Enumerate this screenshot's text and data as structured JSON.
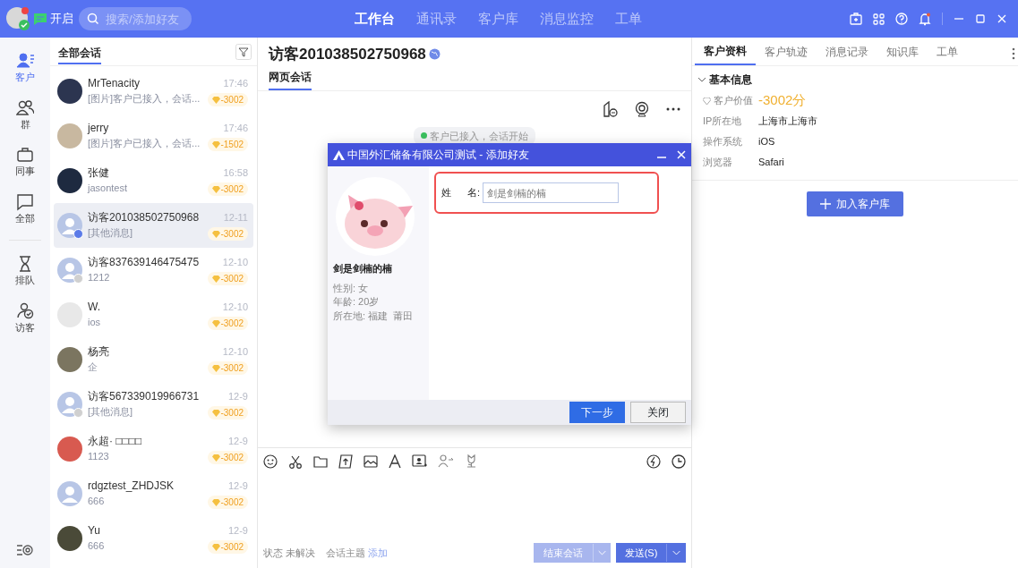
{
  "topbar": {
    "status_label": "开启",
    "search": {
      "placeholder": "搜索/添加好友"
    },
    "nav": [
      {
        "label": "工作台",
        "selected": true
      },
      {
        "label": "通讯录",
        "selected": false
      },
      {
        "label": "客户库",
        "selected": false
      },
      {
        "label": "消息监控",
        "selected": false
      },
      {
        "label": "工单",
        "selected": false
      }
    ],
    "notification_dot": true
  },
  "rail": [
    {
      "label": "客户",
      "selected": true
    },
    {
      "label": "群",
      "selected": false
    },
    {
      "label": "同事",
      "selected": false
    },
    {
      "label": "全部",
      "selected": false
    },
    {
      "label": "排队",
      "selected": false
    },
    {
      "label": "访客",
      "selected": false
    }
  ],
  "conversation_list": {
    "title": "全部会话",
    "items": [
      {
        "name": "MrTenacity",
        "time": "17:46",
        "preview": "[图片]客户已接入，会话...",
        "score": "-3002",
        "kind": "photo",
        "selected": false
      },
      {
        "name": "jerry",
        "time": "17:46",
        "preview": "[图片]客户已接入，会话...",
        "score": "-1502",
        "kind": "photo",
        "selected": false
      },
      {
        "name": "张健",
        "time": "16:58",
        "preview": "jasontest",
        "score": "-3002",
        "kind": "photo",
        "selected": false
      },
      {
        "name": "访客201038502750968",
        "time": "12-11",
        "preview": "[其他消息]",
        "score": "-3002",
        "kind": "web_visitor",
        "selected": true
      },
      {
        "name": "访客837639146475475",
        "time": "12-10",
        "preview": "1212",
        "score": "-3002",
        "kind": "offline_visitor",
        "selected": false
      },
      {
        "name": "W.",
        "time": "12-10",
        "preview": "ios",
        "score": "-3002",
        "kind": "photo",
        "selected": false
      },
      {
        "name": "杨亮",
        "time": "12-10",
        "preview": "企",
        "score": "-3002",
        "kind": "photo",
        "selected": false
      },
      {
        "name": "访客567339019966731",
        "time": "12-9",
        "preview": "[其他消息]",
        "score": "-3002",
        "kind": "offline_visitor",
        "selected": false
      },
      {
        "name": "永超· □□□□",
        "time": "12-9",
        "preview": "1123",
        "score": "-3002",
        "kind": "photo",
        "selected": false
      },
      {
        "name": "rdgztest_ZHDJSK",
        "time": "12-9",
        "preview": "666",
        "score": "-3002",
        "kind": "default",
        "selected": false
      },
      {
        "name": "Yu",
        "time": "12-9",
        "preview": "666",
        "score": "-3002",
        "kind": "photo",
        "selected": false
      }
    ]
  },
  "chat": {
    "title": "访客201038502750968",
    "tabs": [
      {
        "label": "网页会话",
        "selected": true
      }
    ],
    "system_message": "客户已接入，会话开始",
    "footer": {
      "status_label": "状态",
      "status_value": "未解决",
      "topic_label": "会话主题",
      "topic_link": "添加",
      "end_button": "结束会话",
      "send_button": "发送(S)"
    }
  },
  "dialog": {
    "title": "中国外汇储备有限公司测试 - 添加好友",
    "profile_name": "剑是剑楠的楠",
    "details": [
      "性别: 女",
      "年龄: 20岁",
      "所在地: 福建  莆田"
    ],
    "field_label_1": "姓",
    "field_label_2": "名:",
    "field_placeholder": "剑是剑楠的楠",
    "next_button": "下一步",
    "close_button": "关闭"
  },
  "customer_panel": {
    "tabs": [
      {
        "label": "客户资料",
        "selected": true
      },
      {
        "label": "客户轨迹",
        "selected": false
      },
      {
        "label": "消息记录",
        "selected": false
      },
      {
        "label": "知识库",
        "selected": false
      },
      {
        "label": "工单",
        "selected": false
      }
    ],
    "section": {
      "title": "基本信息",
      "expanded": true,
      "rows": [
        {
          "label": "客户价值",
          "value": "-3002分",
          "kind": "score"
        },
        {
          "label": "IP所在地",
          "value": "上海市上海市",
          "kind": "text"
        },
        {
          "label": "操作系统",
          "value": "iOS",
          "kind": "text"
        },
        {
          "label": "浏览器",
          "value": "Safari",
          "kind": "text"
        }
      ]
    },
    "add_button": "加入客户库"
  }
}
